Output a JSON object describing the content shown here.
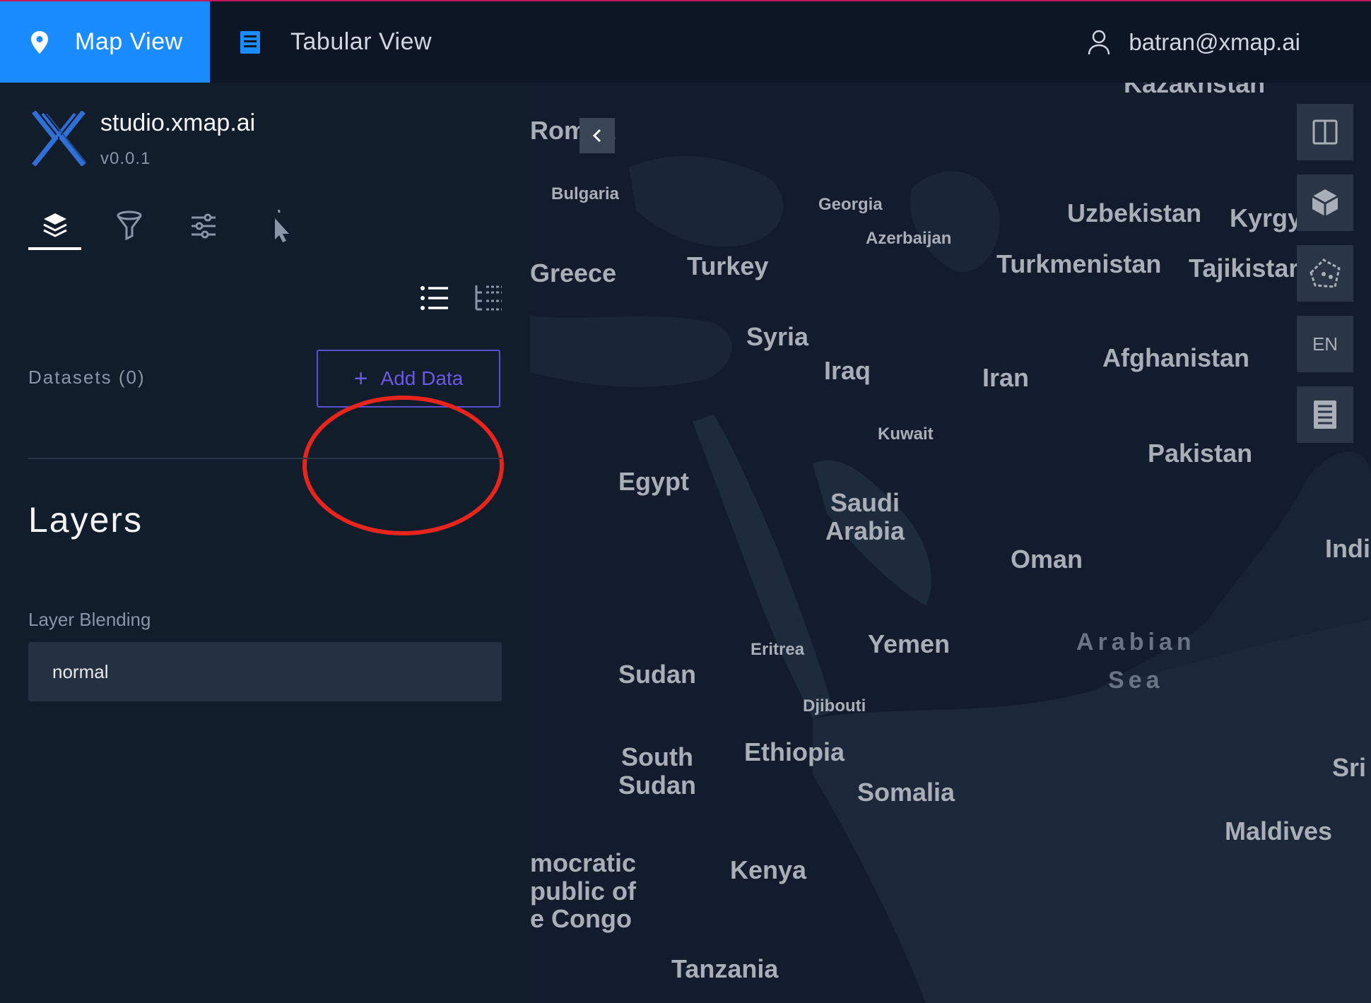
{
  "header": {
    "tabs": [
      {
        "label": "Map View",
        "active": true,
        "icon": "map-pin-icon"
      },
      {
        "label": "Tabular View",
        "active": false,
        "icon": "table-icon"
      }
    ],
    "user_email": "batran@xmap.ai",
    "accent_color": "#1a8cff"
  },
  "sidebar": {
    "brand": {
      "title": "studio.xmap.ai",
      "version": "v0.0.1"
    },
    "panel_tabs": [
      "layers-icon",
      "filter-icon",
      "sliders-icon",
      "pointer-icon"
    ],
    "datasets_label": "Datasets (0)",
    "add_data_label": "Add Data",
    "layers_title": "Layers",
    "layer_blending_label": "Layer Blending",
    "layer_blending_value": "normal"
  },
  "map": {
    "labels": {
      "romania": "Rom  ia",
      "bulgaria": "Bulgaria",
      "greece": "Greece",
      "turkey": "Turkey",
      "georgia": "Georgia",
      "azerbaijan": "Azerbaijan",
      "kazakhstan": "Kazakhstan",
      "uzbekistan": "Uzbekistan",
      "kyrgyz": "Kyrgy    n",
      "turkmenistan": "Turkmenistan",
      "tajikistan": "Tajikistar",
      "syria": "Syria",
      "iraq": "Iraq",
      "iran": "Iran",
      "afghanistan": "Afghanistan",
      "kuwait": "Kuwait",
      "pakistan": "Pakistan",
      "egypt": "Egypt",
      "saudi_arabia": "Saudi\nArabia",
      "oman": "Oman",
      "india": "Indi",
      "eritrea": "Eritrea",
      "yemen": "Yemen",
      "arabian_sea": "Arabian\nSea",
      "sudan": "Sudan",
      "djibouti": "Djibouti",
      "south_sudan": "South\nSudan",
      "ethiopia": "Ethiopia",
      "somalia": "Somalia",
      "sri": "Sri",
      "maldives": "Maldives",
      "drc": "mocratic\npublic of\ne Congo",
      "kenya": "Kenya",
      "tanzania": "Tanzania"
    },
    "controls": {
      "split_icon": "split-view-icon",
      "cube_icon": "3d-cube-icon",
      "draw_icon": "polygon-draw-icon",
      "lang": "EN",
      "legend_icon": "legend-icon"
    }
  }
}
